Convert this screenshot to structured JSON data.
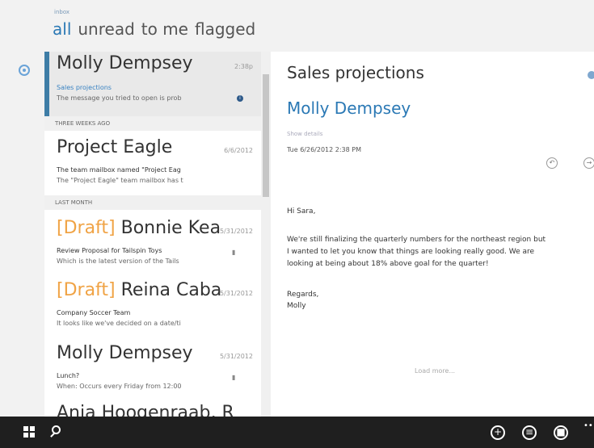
{
  "header": {
    "inbox_label": "inbox",
    "pivots": [
      "all",
      "unread",
      "to me",
      "flagged"
    ]
  },
  "list": {
    "messages": [
      {
        "sender": "Molly Dempsey",
        "date": "2:38p",
        "subject": "Sales projections",
        "preview": "The message you tried to open is prob"
      },
      {
        "sender": "Project Eagle",
        "date": "6/6/2012",
        "subject": "The team mailbox named \"Project Eag",
        "preview": "The \"Project Eagle\" team mailbox has t"
      },
      {
        "draft": "[Draft]",
        "sender": "Bonnie Kea",
        "date": "5/31/2012",
        "subject": "Review Proposal for Tailspin Toys",
        "preview": "Which is the latest version of the Tails"
      },
      {
        "draft": "[Draft]",
        "sender": "Reina Caba",
        "date": "5/31/2012",
        "subject": "Company Soccer Team",
        "preview": "It looks like we've decided on a date/ti"
      },
      {
        "sender": "Molly Dempsey",
        "date": "5/31/2012",
        "subject": "Lunch?",
        "preview": "When: Occurs every Friday from 12:00"
      },
      {
        "sender": "Anja Hoogenraab, R"
      }
    ],
    "dividers": [
      "THREE WEEKS AGO",
      "LAST MONTH"
    ]
  },
  "reading": {
    "subject": "Sales projections",
    "sender": "Molly Dempsey",
    "show_details": "Show details",
    "date": "Tue 6/26/2012 2:38 PM",
    "body": [
      "Hi Sara,",
      "We're still finalizing the quarterly numbers for the northeast region but",
      "I wanted to let you know that things are looking really good.  We are",
      "looking at being about 18% above goal for the quarter!",
      "Regards,",
      "Molly"
    ],
    "load_more": "Load more..."
  },
  "colors": {
    "accent": "#2b79b5",
    "draft": "#f0a345",
    "taskbar": "#1f1f1f"
  },
  "icons": [
    "start-icon",
    "search-icon",
    "new-icon",
    "reply-icon",
    "more-icon"
  ]
}
